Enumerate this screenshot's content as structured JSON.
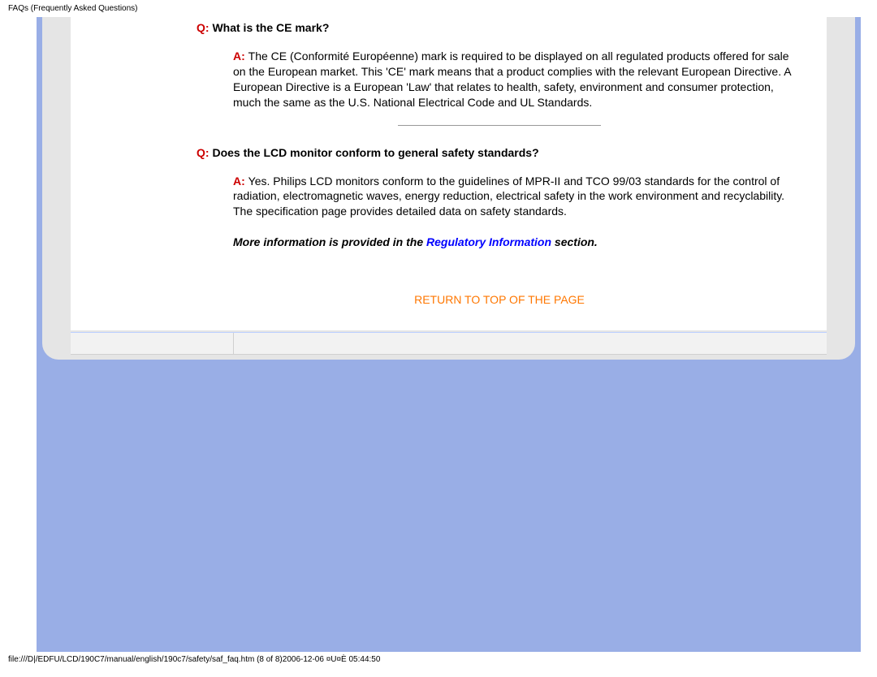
{
  "header": "FAQs (Frequently Asked Questions)",
  "faq1": {
    "q_prefix": "Q: ",
    "q_text": "What is the CE mark?",
    "a_prefix": "A: ",
    "a_text": "The CE (Conformité Européenne) mark is required to be displayed on all regulated products offered for sale on the European market. This 'CE' mark means that a product complies with the relevant European Directive. A European Directive is a European 'Law' that relates to health, safety, environment and consumer protection, much the same as the U.S. National Electrical Code and UL Standards."
  },
  "faq2": {
    "q_prefix": "Q: ",
    "q_text": "Does the LCD monitor conform to general safety standards?",
    "a_prefix": "A: ",
    "a_text": "Yes. Philips LCD monitors conform to the guidelines of MPR-II and TCO 99/03 standards for the control of radiation, electromagnetic waves, energy reduction, electrical safety in the work environment and recyclability. The specification page provides detailed data on safety standards."
  },
  "more_info": {
    "before": "More information is provided in the ",
    "link": "Regulatory Information",
    "after": " section."
  },
  "return_link": "RETURN TO TOP OF THE PAGE",
  "footer": "file:///D|/EDFU/LCD/190C7/manual/english/190c7/safety/saf_faq.htm (8 of 8)2006-12-06 ¤U¤È 05:44:50"
}
